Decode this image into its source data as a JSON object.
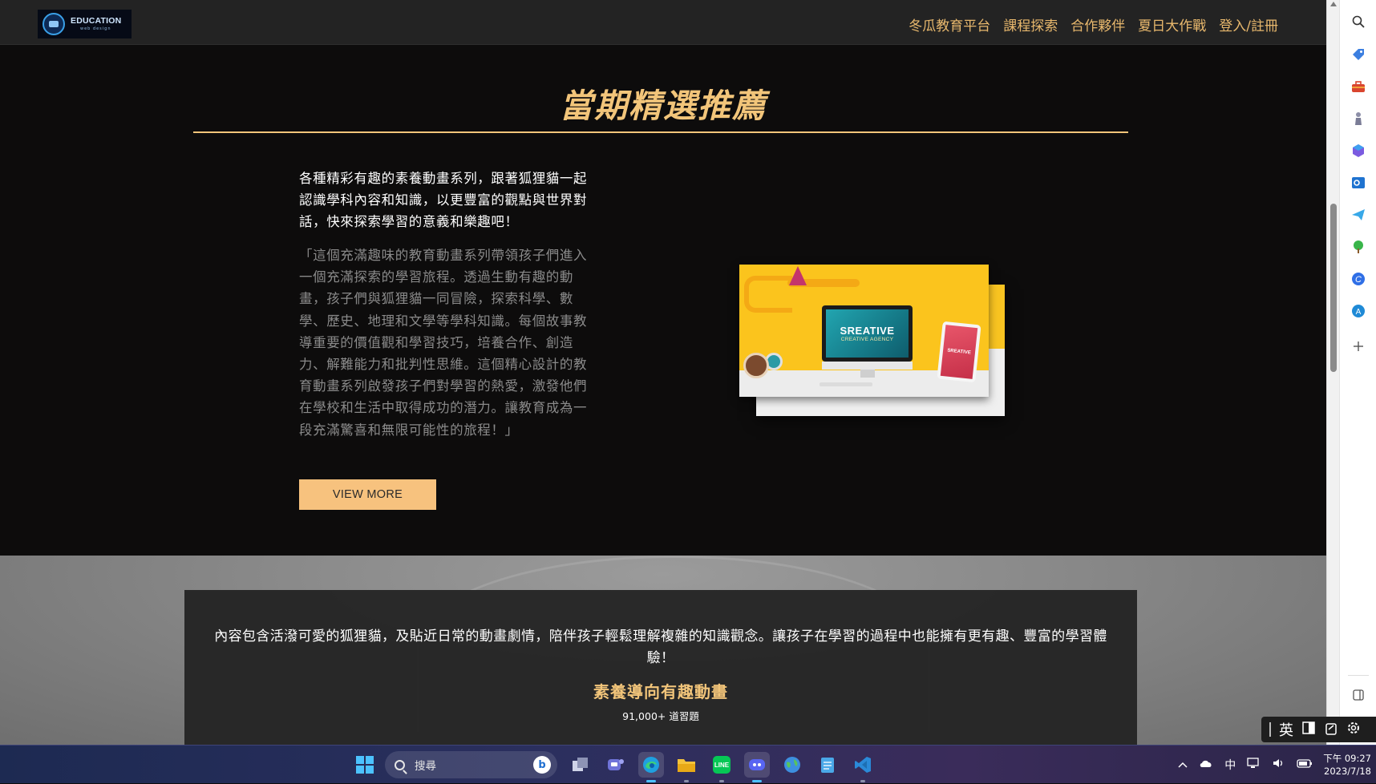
{
  "nav": {
    "logo_text": "EDUCATION",
    "logo_subtext": "web design",
    "links": [
      "冬瓜教育平台",
      "課程探索",
      "合作夥伴",
      "夏日大作戰",
      "登入/註冊"
    ]
  },
  "featured": {
    "title": "當期精選推薦",
    "intro": "各種精彩有趣的素養動畫系列，跟著狐狸貓一起認識學科內容和知識，以更豐富的觀點與世界對話，快來探索學習的意義和樂趣吧！",
    "quote": "「這個充滿趣味的教育動畫系列帶領孩子們進入一個充滿探索的學習旅程。透過生動有趣的動畫，孩子們與狐狸貓一同冒險，探索科學、數學、歷史、地理和文學等學科知識。每個故事教導重要的價值觀和學習技巧，培養合作、創造力、解難能力和批判性思維。這個精心設計的教育動畫系列啟發孩子們對學習的熱愛，激發他們在學校和生活中取得成功的潛力。讓教育成為一段充滿驚喜和無限可能性的旅程！」",
    "button_label": "VIEW MORE",
    "image": {
      "screen_title": "SREATIVE",
      "screen_subtitle": "CREATIVE AGENCY",
      "tablet_text": "SREATIVE"
    }
  },
  "lower": {
    "text": "內容包含活潑可愛的狐狸貓，及貼近日常的動畫劇情，陪伴孩子輕鬆理解複雜的知識觀念。讓孩子在學習的過程中也能擁有更有趣、豐富的學習體驗！",
    "heading": "素養導向有趣動畫",
    "count": "91,000+ 道習題"
  },
  "edge_sidebar": {
    "icons": [
      "search-icon",
      "tag-icon",
      "toolbox-icon",
      "chess-icon",
      "office-icon",
      "outlook-icon",
      "send-icon",
      "tree-icon",
      "c-icon",
      "a-icon",
      "plus-icon",
      "panel-icon"
    ]
  },
  "ime": {
    "lang": "英"
  },
  "taskbar": {
    "search_placeholder": "搜尋",
    "bing_label": "b",
    "apps": [
      "task-view",
      "teams",
      "edge",
      "file-explorer",
      "line",
      "discord",
      "browser",
      "notepad",
      "vscode"
    ],
    "tray_lang": "中",
    "time": "下午 09:27",
    "date": "2023/7/18"
  },
  "colors": {
    "accent_gold": "#f2c57a",
    "button_bg": "#f7c27e",
    "page_bg": "#0d0c0c",
    "nav_bg": "#232323"
  }
}
